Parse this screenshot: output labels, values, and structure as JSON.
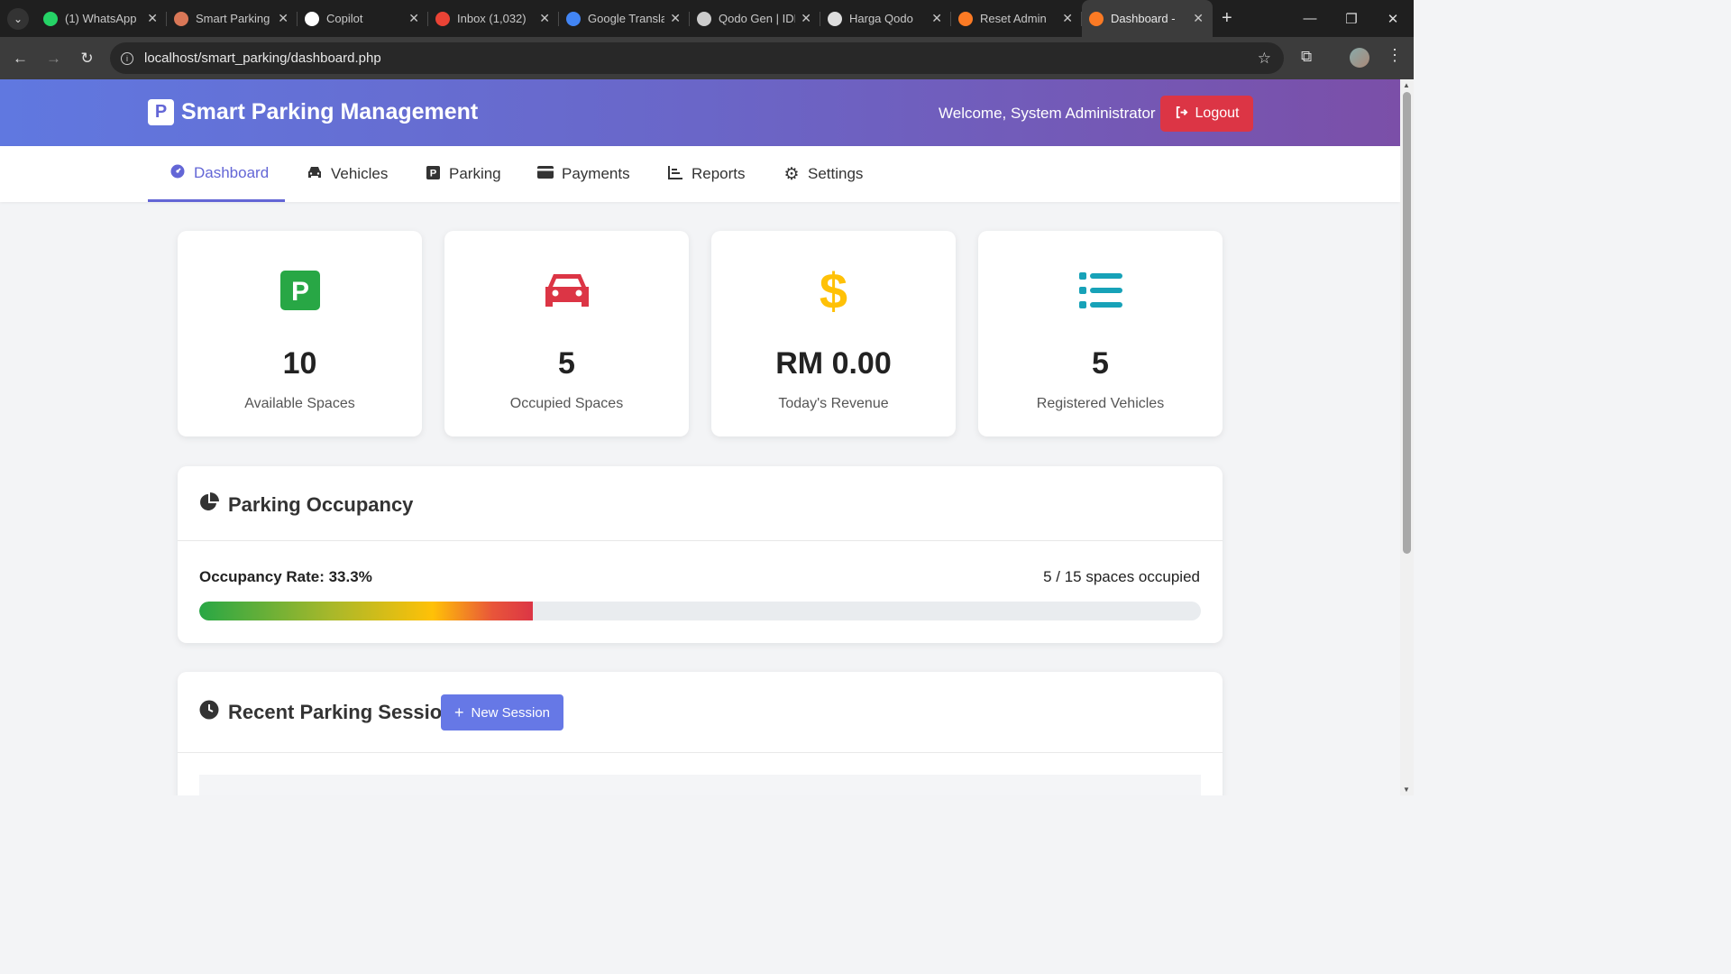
{
  "browser": {
    "tabs": [
      {
        "label": "(1) WhatsApp",
        "icon": "whatsapp-icon",
        "color": "#25d366"
      },
      {
        "label": "Smart Parking",
        "icon": "claude-icon",
        "color": "#d97757"
      },
      {
        "label": "Copilot",
        "icon": "github-icon",
        "color": "#ffffff"
      },
      {
        "label": "Inbox (1,032)",
        "icon": "gmail-icon",
        "color": "#ea4335"
      },
      {
        "label": "Google Translate",
        "icon": "translate-icon",
        "color": "#4285f4"
      },
      {
        "label": "Qodo Gen | IDE",
        "icon": "qodo-icon",
        "color": "#cccccc"
      },
      {
        "label": "Harga Qodo",
        "icon": "openai-icon",
        "color": "#dddddd"
      },
      {
        "label": "Reset Admin",
        "icon": "xampp-icon",
        "color": "#fb7a24"
      },
      {
        "label": "Dashboard -",
        "icon": "xampp-icon",
        "color": "#fb7a24"
      }
    ],
    "url": "localhost/smart_parking/dashboard.php"
  },
  "header": {
    "brand": "Smart Parking Management",
    "brand_logo": "P",
    "welcome": "Welcome, System Administrator",
    "logout": "Logout"
  },
  "nav": {
    "items": [
      {
        "label": "Dashboard",
        "icon": "dashboard-icon"
      },
      {
        "label": "Vehicles",
        "icon": "car-icon"
      },
      {
        "label": "Parking",
        "icon": "parking-icon"
      },
      {
        "label": "Payments",
        "icon": "credit-card-icon"
      },
      {
        "label": "Reports",
        "icon": "chart-icon"
      },
      {
        "label": "Settings",
        "icon": "gear-icon"
      }
    ],
    "active": "Dashboard"
  },
  "stats": [
    {
      "value": "10",
      "label": "Available Spaces",
      "icon": "parking-icon",
      "color": "#28a745"
    },
    {
      "value": "5",
      "label": "Occupied Spaces",
      "icon": "car-icon",
      "color": "#dc3545"
    },
    {
      "value": "RM 0.00",
      "label": "Today's Revenue",
      "icon": "dollar-icon",
      "color": "#ffc107"
    },
    {
      "value": "5",
      "label": "Registered Vehicles",
      "icon": "list-icon",
      "color": "#17a2b8"
    }
  ],
  "occupancy": {
    "title": "Parking Occupancy",
    "rate_label": "Occupancy Rate: 33.3%",
    "count_label": "5 / 15 spaces occupied",
    "rate_fraction": 0.333
  },
  "recent": {
    "title": "Recent Parking Sessions",
    "new_session": "New Session"
  },
  "colors": {
    "accent": "#6366d6",
    "danger": "#dc3545",
    "header_start": "#6078e0",
    "header_end": "#7b4fa8"
  }
}
